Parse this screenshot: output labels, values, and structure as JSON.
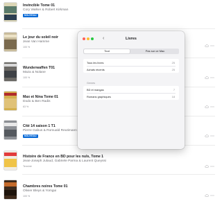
{
  "books": [
    {
      "title": "Invincible Tome 01",
      "author": "Cory Walker & Robert Kirkman",
      "badge": "NOUVEAU",
      "meta": ""
    },
    {
      "title": "Le jour du soleil noir",
      "author": "Jean Van Hamme",
      "badge": "",
      "meta": "100 %"
    },
    {
      "title": "Wunderwaffen T01",
      "author": "Maza & Nolane",
      "badge": "",
      "meta": "100 %"
    },
    {
      "title": "Max et Nina Tome 01",
      "author": "Dodo & Ben Radis",
      "badge": "",
      "meta": "63 %"
    },
    {
      "title": "Cité 14 saison 1 T1",
      "author": "Pierre Gabus & Romuald Reutimann",
      "badge": "NOUVEAU",
      "meta": ""
    },
    {
      "title": "Histoire de France en BD pour les nuls, Tome 1",
      "author": "Jean-Joseph Julaud, Gabriele Parma & Laurent Queyssi",
      "badge": "",
      "meta": "Terminé"
    },
    {
      "title": "Chambres noires Tome 01",
      "author": "Olivier Bleys & Yomgui",
      "badge": "",
      "meta": "100 %"
    }
  ],
  "dialog": {
    "title": "Livres",
    "back_glyph": "‹",
    "tabs": [
      {
        "label": "Tout",
        "selected": true
      },
      {
        "label": "Pas sur ce Mac",
        "selected": false
      }
    ],
    "collections": [
      {
        "label": "Tous les livres",
        "count": "25"
      },
      {
        "label": "Achats récents",
        "count": "25"
      }
    ],
    "genres_header": "Genres",
    "genres": [
      {
        "label": "BD et mangas",
        "count": "7"
      },
      {
        "label": "Romans graphiques",
        "count": "18"
      }
    ]
  },
  "colors": {
    "accent": "#0a6ad6",
    "covers": [
      "#d9d4b4",
      "#b7a98f",
      "#6c6a66",
      "#c8a84a",
      "#8c8f94",
      "#f1ede2",
      "#3d2a1c"
    ]
  },
  "icons": {
    "cloud": "cloud-download-icon",
    "more": "more-dots-icon"
  }
}
